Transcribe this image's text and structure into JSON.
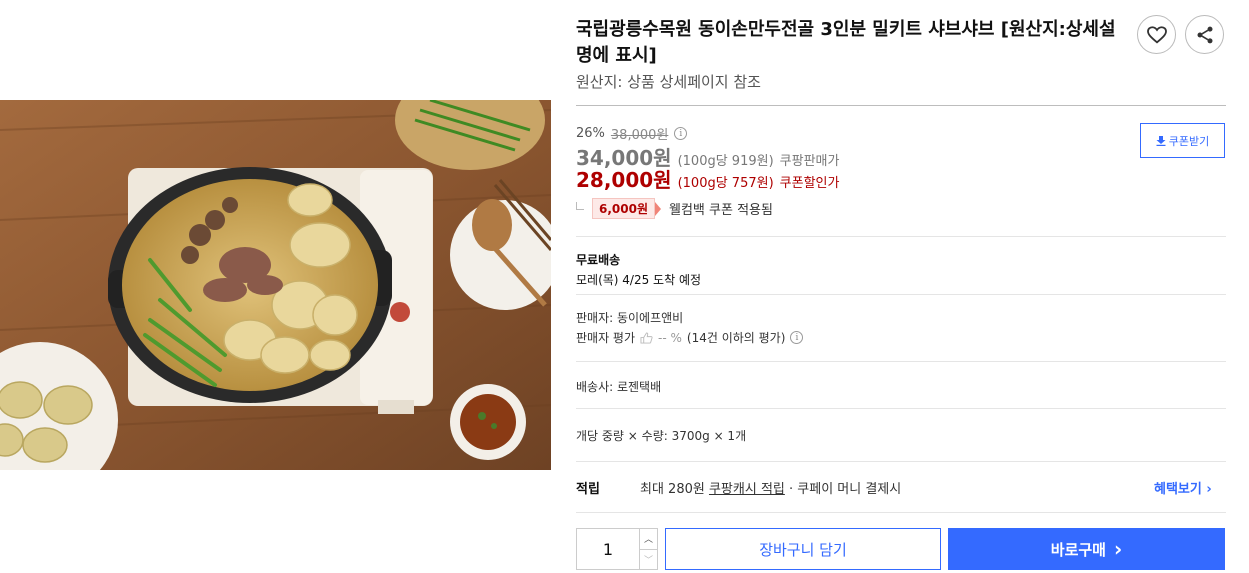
{
  "product": {
    "title": "국립광릉수목원 동이손만두전골 3인분 밀키트 샤브샤브 [원산지:상세설명에 표시]",
    "origin": "원산지: 상품 상세페이지 참조",
    "image_alt": "동이손만두전골 밀키트 이미지"
  },
  "actions": {
    "wishlist_icon": "heart-icon",
    "share_icon": "share-icon"
  },
  "price": {
    "discount_rate": "26%",
    "original_price": "38,000원",
    "sale_price": "34,000원",
    "sale_unit": "(100g당 919원)",
    "sale_label": "쿠팡판매가",
    "coupon_price": "28,000원",
    "coupon_unit": "(100g당 757원)",
    "coupon_label": "쿠폰할인가",
    "coupon_button": "쿠폰받기",
    "welcome_amount": "6,000원",
    "welcome_text": "웰컴백 쿠폰 적용됨"
  },
  "shipping": {
    "title": "무료배송",
    "arrival": "모레(목) 4/25 도착 예정"
  },
  "seller": {
    "name": "판매자: 동이에프앤비",
    "rating_label": "판매자 평가",
    "rating_value": "-- %",
    "rating_note": "(14건 이하의 평가)"
  },
  "courier": "배송사: 로젠택배",
  "weight": "개당 중량 × 수량: 3700g × 1개",
  "reward": {
    "label": "적립",
    "prefix": "최대 280원",
    "link": "쿠팡캐시 적립",
    "suffix": "· 쿠페이 머니 결제시",
    "benefit_link": "혜택보기"
  },
  "purchase": {
    "quantity": "1",
    "cart_button": "장바구니 담기",
    "buy_button": "바로구매"
  }
}
